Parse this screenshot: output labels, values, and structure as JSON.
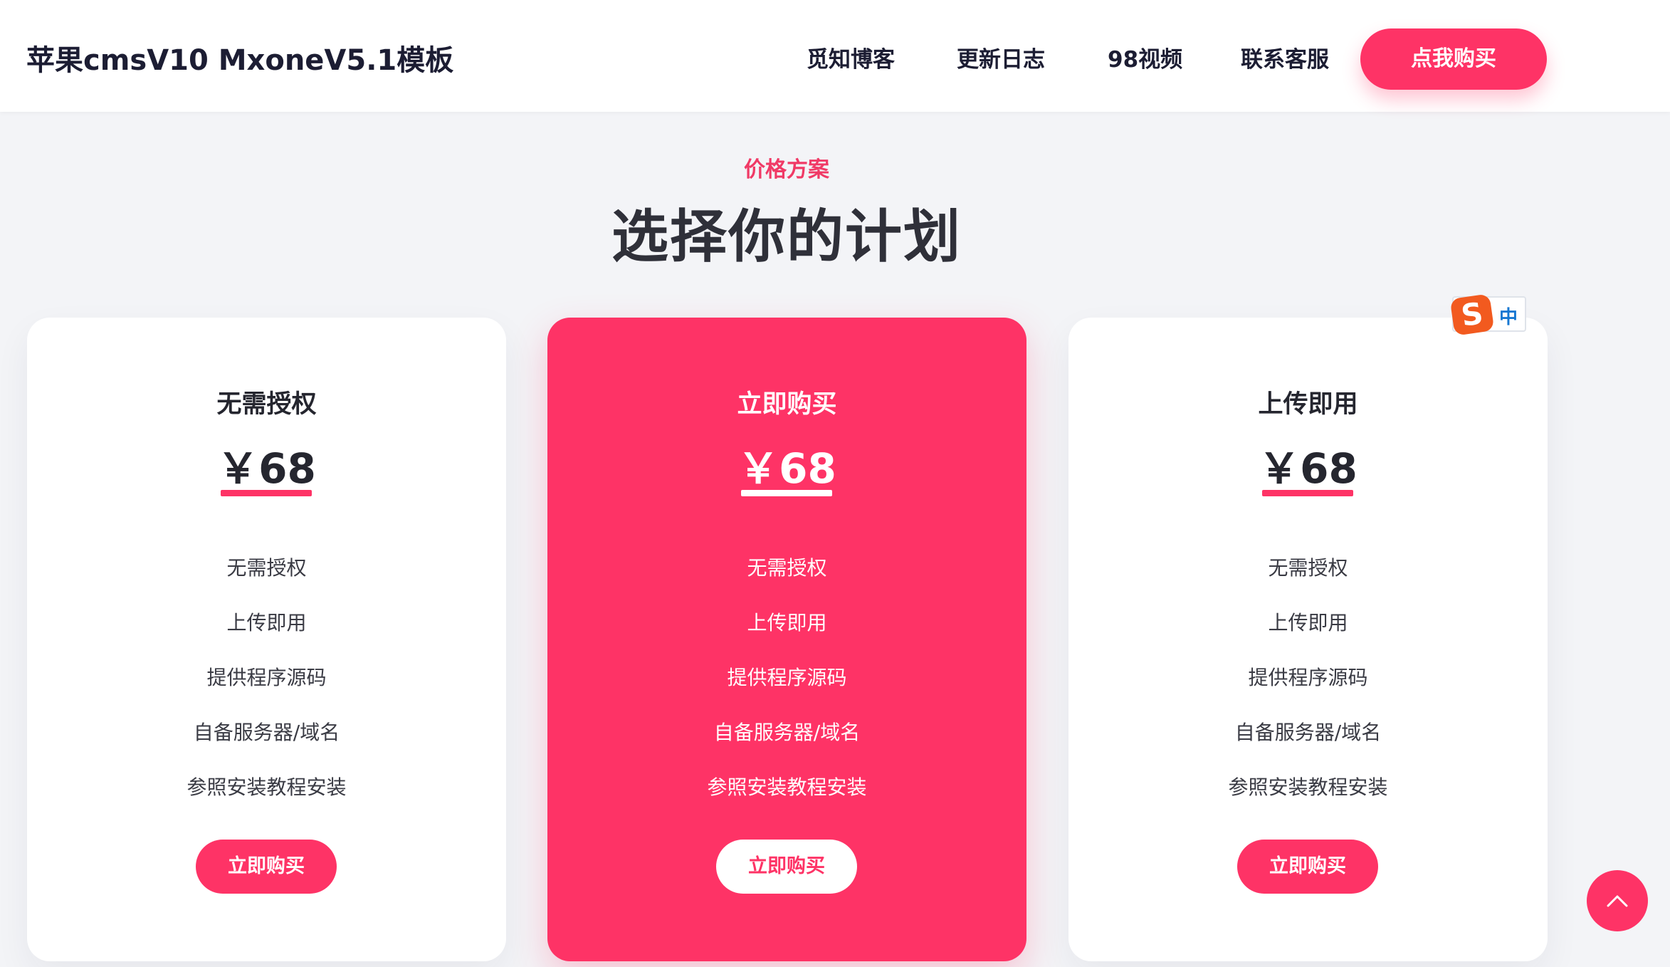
{
  "header": {
    "brand": "苹果cmsV10 MxoneV5.1模板",
    "nav": [
      "觅知博客",
      "更新日志",
      "98视频",
      "联系客服"
    ],
    "buy_label": "点我购买"
  },
  "section": {
    "eyebrow": "价格方案",
    "title": "选择你的计划"
  },
  "plans": [
    {
      "name": "无需授权",
      "price": "￥68",
      "features": [
        "无需授权",
        "上传即用",
        "提供程序源码",
        "自备服务器/域名",
        "参照安装教程安装"
      ],
      "button": "立即购买"
    },
    {
      "name": "立即购买",
      "price": "￥68",
      "features": [
        "无需授权",
        "上传即用",
        "提供程序源码",
        "自备服务器/域名",
        "参照安装教程安装"
      ],
      "button": "立即购买"
    },
    {
      "name": "上传即用",
      "price": "￥68",
      "features": [
        "无需授权",
        "上传即用",
        "提供程序源码",
        "自备服务器/域名",
        "参照安装教程安装"
      ],
      "button": "立即购买"
    }
  ],
  "ime": {
    "mode": "中"
  },
  "colors": {
    "accent": "#fe3366",
    "heading": "#2f3039",
    "background": "#f3f4f7"
  },
  "icons": {
    "back_to_top": "chevron-up-icon",
    "ime": "sogou-ime-icon"
  }
}
